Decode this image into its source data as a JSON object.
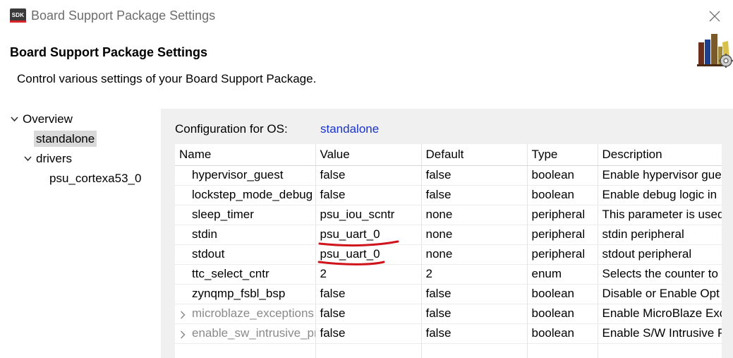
{
  "window": {
    "icon_text": "SDK",
    "title": "Board Support Package Settings"
  },
  "header": {
    "title": "Board Support Package Settings",
    "description": "Control various settings of your Board Support Package."
  },
  "tree": {
    "items": [
      {
        "label": "Overview",
        "expanded": true
      },
      {
        "label": "standalone",
        "selected": true
      },
      {
        "label": "drivers",
        "expanded": true
      },
      {
        "label": "psu_cortexa53_0"
      }
    ]
  },
  "config": {
    "label": "Configuration for OS:",
    "os": "standalone"
  },
  "table": {
    "columns": [
      "Name",
      "Value",
      "Default",
      "Type",
      "Description"
    ],
    "rows": [
      {
        "name": "hypervisor_guest",
        "value": "false",
        "default": "false",
        "type": "boolean",
        "description": "Enable hypervisor gue"
      },
      {
        "name": "lockstep_mode_debug",
        "value": "false",
        "default": "false",
        "type": "boolean",
        "description": "Enable debug logic in"
      },
      {
        "name": "sleep_timer",
        "value": "psu_iou_scntr",
        "default": "none",
        "type": "peripheral",
        "description": "This parameter is used"
      },
      {
        "name": "stdin",
        "value": "psu_uart_0",
        "default": "none",
        "type": "peripheral",
        "description": "stdin peripheral"
      },
      {
        "name": "stdout",
        "value": "psu_uart_0",
        "default": "none",
        "type": "peripheral",
        "description": "stdout peripheral"
      },
      {
        "name": "ttc_select_cntr",
        "value": "2",
        "default": "2",
        "type": "enum",
        "description": "Selects the counter to"
      },
      {
        "name": "zynqmp_fsbl_bsp",
        "value": "false",
        "default": "false",
        "type": "boolean",
        "description": "Disable or Enable Opt"
      },
      {
        "name": "microblaze_exceptions",
        "value": "false",
        "default": "false",
        "type": "boolean",
        "description": "Enable MicroBlaze Exc"
      },
      {
        "name": "enable_sw_intrusive_profiling",
        "value": "false",
        "default": "false",
        "type": "boolean",
        "description": "Enable S/W Intrusive P"
      }
    ]
  },
  "colors": {
    "link": "#1a33c8",
    "panel_bg": "#f0f0f0",
    "annotation": "#d0141c"
  }
}
